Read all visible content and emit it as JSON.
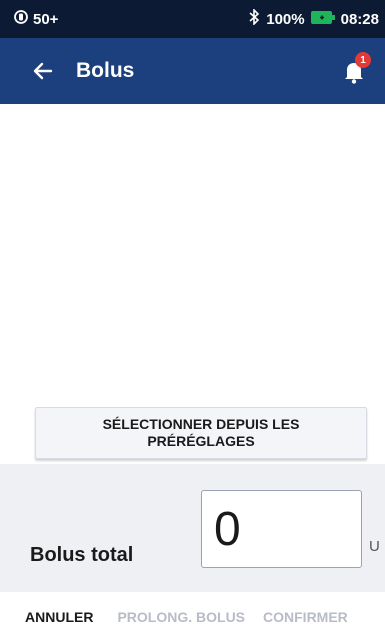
{
  "status_bar": {
    "notification_count": "50+",
    "battery_percent": "100%",
    "time": "08:28",
    "icons": [
      "notification-circle-icon",
      "bluetooth-icon",
      "battery-icon"
    ],
    "battery_color": "#1fb35a"
  },
  "app_bar": {
    "title": "Bolus",
    "back_icon": "arrow-left-icon",
    "bell_icon": "bell-icon",
    "badge_count": "1",
    "badge_color": "#e53935",
    "color": "#1c3f7e"
  },
  "preset_button": {
    "label": "SÉLECTIONNER DEPUIS LES PRÉRÉGLAGES"
  },
  "total": {
    "label": "Bolus total",
    "value": "0",
    "unit": "U"
  },
  "actions": {
    "cancel": "ANNULER",
    "extend": "PROLONG. BOLUS",
    "confirm": "CONFIRMER"
  }
}
